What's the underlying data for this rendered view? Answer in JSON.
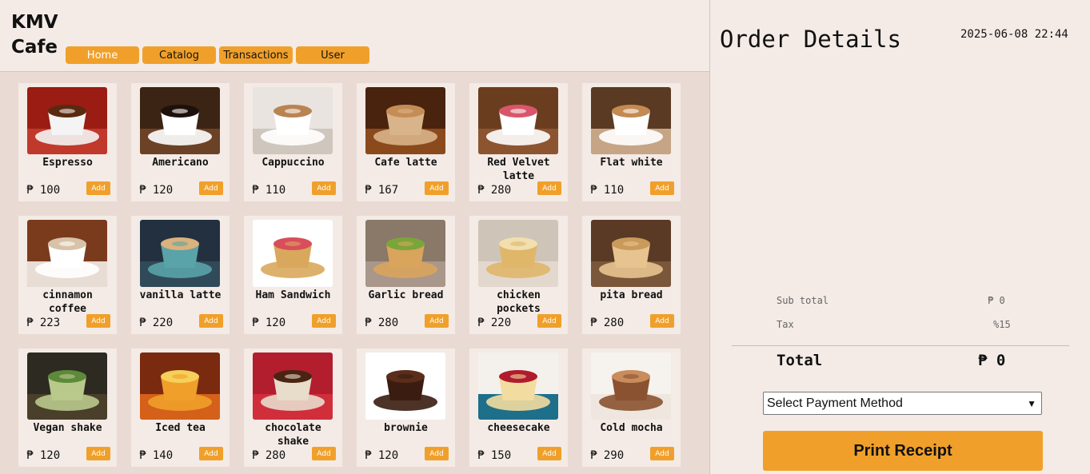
{
  "app": {
    "brand": "KMV Cafe"
  },
  "nav": [
    {
      "label": "Home",
      "active": true
    },
    {
      "label": "Catalog"
    },
    {
      "label": "Transactions"
    },
    {
      "label": "User"
    }
  ],
  "products": [
    {
      "name": "Espresso",
      "price": "₱ 100",
      "add": "Add",
      "image": "espresso-cup"
    },
    {
      "name": "Americano",
      "price": "₱ 120",
      "add": "Add",
      "image": "americano-cup"
    },
    {
      "name": "Cappuccino",
      "price": "₱ 110",
      "add": "Add",
      "image": "cappuccino-cup"
    },
    {
      "name": "Cafe latte",
      "price": "₱ 167",
      "add": "Add",
      "image": "latte-glass"
    },
    {
      "name": "Red Velvet latte",
      "price": "₱ 280",
      "add": "Add",
      "image": "red-velvet-cup"
    },
    {
      "name": "Flat white",
      "price": "₱ 110",
      "add": "Add",
      "image": "flat-white-cup"
    },
    {
      "name": "cinnamon coffee",
      "price": "₱ 223",
      "add": "Add",
      "image": "cinnamon-mug"
    },
    {
      "name": "vanilla latte",
      "price": "₱ 220",
      "add": "Add",
      "image": "vanilla-latte-cup"
    },
    {
      "name": "Ham Sandwich",
      "price": "₱ 120",
      "add": "Add",
      "image": "ham-sandwich"
    },
    {
      "name": "Garlic bread",
      "price": "₱ 280",
      "add": "Add",
      "image": "garlic-bread"
    },
    {
      "name": "chicken pockets",
      "price": "₱ 220",
      "add": "Add",
      "image": "chicken-pockets"
    },
    {
      "name": "pita bread",
      "price": "₱ 280",
      "add": "Add",
      "image": "pita-bread"
    },
    {
      "name": "Vegan shake",
      "price": "₱ 120",
      "add": "Add",
      "image": "green-shake"
    },
    {
      "name": "Iced tea",
      "price": "₱ 140",
      "add": "Add",
      "image": "iced-tea"
    },
    {
      "name": "chocolate shake",
      "price": "₱ 280",
      "add": "Add",
      "image": "chocolate-shake"
    },
    {
      "name": "brownie",
      "price": "₱ 120",
      "add": "Add",
      "image": "brownie"
    },
    {
      "name": "cheesecake",
      "price": "₱ 150",
      "add": "Add",
      "image": "cheesecake"
    },
    {
      "name": "Cold mocha",
      "price": "₱ 290",
      "add": "Add",
      "image": "cold-mocha"
    }
  ],
  "order": {
    "title": "Order Details",
    "datetime": "2025-06-08 22:44",
    "subtotal_label": "Sub total",
    "subtotal_value": "₱ 0",
    "tax_label": "Tax",
    "tax_value": "%15",
    "total_label": "Total",
    "total_value": "₱ 0",
    "payment_placeholder": "Select Payment Method",
    "print_label": "Print Receipt"
  },
  "colors": {
    "accent": "#f0a02a",
    "panel": "#f4ebe6",
    "grid_bg": "#e9dbd3"
  }
}
